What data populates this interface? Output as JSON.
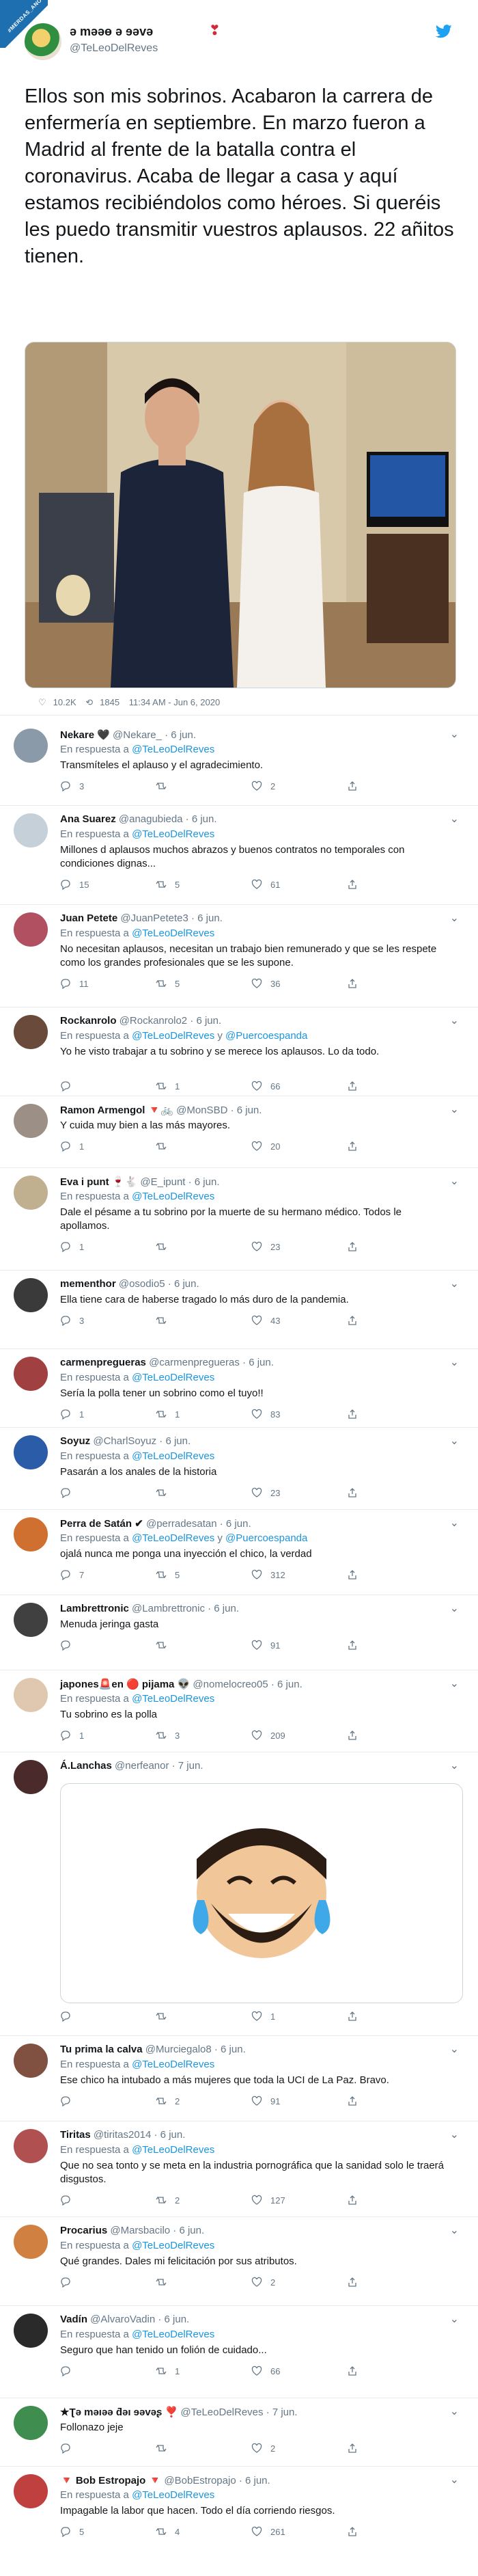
{
  "site_badge": "#MERDAS_ANOS",
  "tweet": {
    "name": "ə məəɵ ə ɘəvə",
    "handle": "@TeLeoDelReves",
    "text": "Ellos son mis sobrinos. Acabaron la carrera de enfermería en septiembre. En marzo fueron a Madrid al frente de la batalla contra el coronavirus. Acaba de llegar a casa y aquí estamos recibiéndolos como héroes. Si queréis les puedo transmitir vuestros aplausos. 22 añitos tienen.",
    "likes": "10.2K",
    "retweets": "1845",
    "timestamp": "11:34 AM - Jun 6, 2020"
  },
  "labels": {
    "in_reply_to": "En respuesta a",
    "and": "y"
  },
  "replies": [
    {
      "name": "Nekare 🖤",
      "handle": "@Nekare_ · 6 jun.",
      "mentions": [
        "@TeLeoDelReves"
      ],
      "text": "Transmíteles el aplauso y el agradecimiento.",
      "replies": "3",
      "retweets": "",
      "likes": "2",
      "color": "#8a9aa8"
    },
    {
      "name": "Ana Suarez",
      "handle": "@anagubieda · 6 jun.",
      "mentions": [
        "@TeLeoDelReves"
      ],
      "text": "Millones d aplausos muchos abrazos y buenos contratos no temporales con condiciones dignas...",
      "replies": "15",
      "retweets": "5",
      "likes": "61",
      "color": "#c5d0d8"
    },
    {
      "name": "Juan Petete",
      "handle": "@JuanPetete3 · 6 jun.",
      "mentions": [
        "@TeLeoDelReves"
      ],
      "text": "No necesitan aplausos, necesitan un trabajo bien remunerado y que se les respete como los grandes profesionales que se les supone.",
      "replies": "11",
      "retweets": "5",
      "likes": "36",
      "color": "#b05060"
    },
    {
      "name": "Rockanrolo",
      "handle": "@Rockanrolo2 · 6 jun.",
      "mentions": [
        "@TeLeoDelReves",
        "@Puercoespanda"
      ],
      "text": "Yo he visto trabajar a tu sobrino y se merece los aplausos. Lo da todo.",
      "replies": "",
      "retweets": "1",
      "likes": "66",
      "color": "#6a4a3a"
    },
    {
      "name": "Ramon Armengol 🔻🚲",
      "handle": "@MonSBD · 6 jun.",
      "mentions": [],
      "text": "Y cuida muy bien a las más mayores.",
      "replies": "1",
      "retweets": "",
      "likes": "20",
      "color": "#9c8f86"
    },
    {
      "name": "Eva i punt 🍷🐇",
      "handle": "@E_ipunt · 6 jun.",
      "mentions": [
        "@TeLeoDelReves"
      ],
      "text": "Dale el pésame a tu sobrino por la muerte de su hermano médico. Todos le apollamos.",
      "replies": "1",
      "retweets": "",
      "likes": "23",
      "color": "#c0b090"
    },
    {
      "name": "mementhor",
      "handle": "@osodio5 · 6 jun.",
      "mentions": [],
      "text": "Ella tiene cara de haberse tragado lo más duro de la pandemia.",
      "replies": "3",
      "retweets": "",
      "likes": "43",
      "color": "#3a3a3a"
    },
    {
      "name": "carmenpregueras",
      "handle": "@carmenpregueras · 6 jun.",
      "mentions": [
        "@TeLeoDelReves"
      ],
      "text": "Sería la polla tener un sobrino como el tuyo!!",
      "replies": "1",
      "retweets": "1",
      "likes": "83",
      "color": "#a04040"
    },
    {
      "name": "Soyuz",
      "handle": "@CharlSoyuz · 6 jun.",
      "mentions": [
        "@TeLeoDelReves"
      ],
      "text": "Pasarán a los anales de la historia",
      "replies": "",
      "retweets": "",
      "likes": "23",
      "color": "#2a5ca8"
    },
    {
      "name": "Perra de Satán ✔",
      "handle": "@perradesatan · 6 jun.",
      "mentions": [
        "@TeLeoDelReves",
        "@Puercoespanda"
      ],
      "text": "ojalá nunca me ponga una inyección el chico, la verdad",
      "replies": "7",
      "retweets": "5",
      "likes": "312",
      "color": "#d07030"
    },
    {
      "name": "Lambrettronic",
      "handle": "@Lambrettronic · 6 jun.",
      "mentions": [],
      "text": "Menuda jeringa gasta",
      "replies": "",
      "retweets": "",
      "likes": "91",
      "color": "#404040"
    },
    {
      "name": "japones🚨en 🔴 pijama 👽",
      "handle": "@nomelocreo05 · 6 jun.",
      "mentions": [
        "@TeLeoDelReves"
      ],
      "text": "Tu sobrino es la polla",
      "replies": "1",
      "retweets": "3",
      "likes": "209",
      "color": "#e0c8b0"
    },
    {
      "name": "Á.Lanchas",
      "handle": "@nerfeanor · 7 jun.",
      "mentions": [],
      "text": "",
      "replies": "",
      "retweets": "",
      "likes": "1",
      "color": "#4a2a2a"
    },
    {
      "name": "Tu prima la calva",
      "handle": "@Murciegalo8 · 6 jun.",
      "mentions": [
        "@TeLeoDelReves"
      ],
      "text": "Ese chico ha intubado a más mujeres que toda la UCI de La Paz. Bravo.",
      "replies": "",
      "retweets": "2",
      "likes": "91",
      "color": "#805040"
    },
    {
      "name": "Tiritas",
      "handle": "@tiritas2014 · 6 jun.",
      "mentions": [
        "@TeLeoDelReves"
      ],
      "text": "Que no sea tonto y se meta en la industria pornográfica que la sanidad solo le traerá disgustos.",
      "replies": "",
      "retweets": "2",
      "likes": "127",
      "color": "#b05050"
    },
    {
      "name": "Procarius",
      "handle": "@Marsbacilo · 6 jun.",
      "mentions": [
        "@TeLeoDelReves"
      ],
      "text": "Qué grandes. Dales mi felicitación por sus  atributos.",
      "replies": "",
      "retweets": "",
      "likes": "2",
      "color": "#d08040"
    },
    {
      "name": "Vadín",
      "handle": "@AlvaroVadin · 6 jun.",
      "mentions": [
        "@TeLeoDelReves"
      ],
      "text": "Seguro que han tenido un folión de cuidado...",
      "replies": "",
      "retweets": "1",
      "likes": "66",
      "color": "#2a2a2a"
    },
    {
      "name": "★Ʈə məıəə ƌəı ɘəvəʂ ❣️",
      "handle": "@TeLeoDelReves · 7 jun.",
      "mentions": [],
      "text": "Follonazo jeje",
      "replies": "",
      "retweets": "",
      "likes": "2",
      "color": "#3f8e4f"
    },
    {
      "name": "🔻 Bob Estropajo 🔻",
      "handle": "@BobEstropajo · 6 jun.",
      "mentions": [
        "@TeLeoDelReves"
      ],
      "text": "Impagable la labor que hacen. Todo el día corriendo riesgos.",
      "replies": "5",
      "retweets": "4",
      "likes": "261",
      "color": "#c04040"
    }
  ]
}
